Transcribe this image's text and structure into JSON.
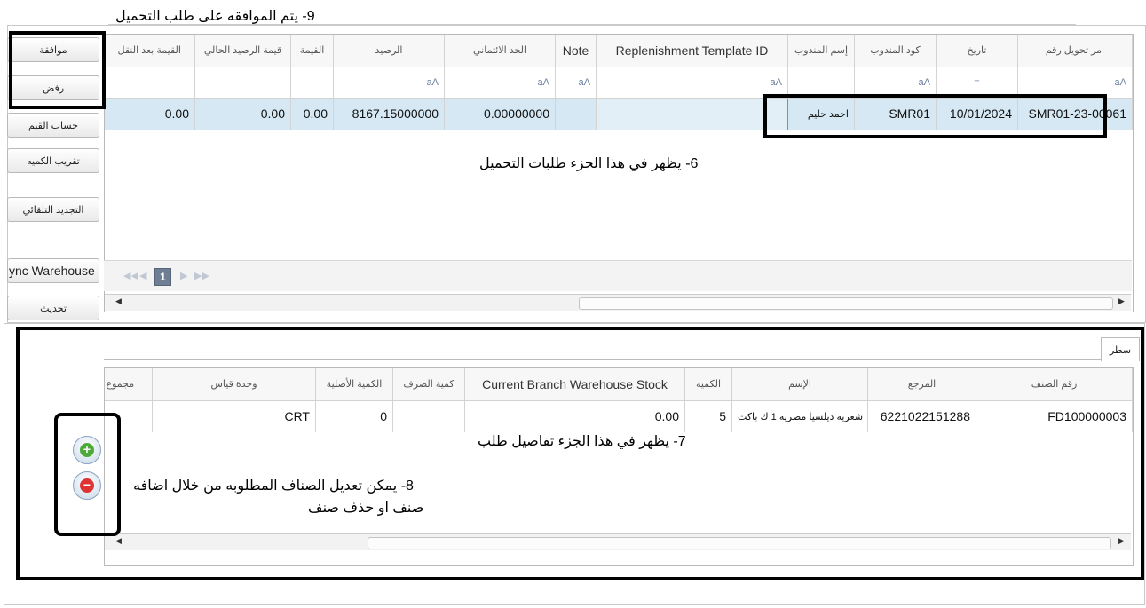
{
  "annotations": {
    "n9": "9- يتم الموافقه على طلب التحميل",
    "n6": "6- يظهر في هذا الجزء طلبات التحميل",
    "n7": "7- يظهر في هذا الجزء تفاصيل طلب",
    "n8_line1": "8- يمكن تعديل الصناف المطلوبه من خلال اضافه",
    "n8_line2": "صنف او حذف صنف"
  },
  "actions": {
    "approve": "موافقة",
    "reject": "رفض",
    "calc_values": "حساب القيم",
    "round_qty": "تقريب الكميه",
    "auto_renew": "التجديد التلقائي",
    "sync_warehouse": "ync Warehouse",
    "refresh": "تحديث"
  },
  "requests": {
    "headers": [
      "امر تحويل رقم",
      "تاريخ",
      "كود المندوب",
      "إسم المندوب",
      "Replenishment Template ID",
      "Note",
      "الحد الائتماني",
      "الرصيد",
      "القيمة",
      "قيمة الرصيد الحالي",
      "القيمة بعد النقل"
    ],
    "filters": [
      "aA",
      "=",
      "aA",
      "",
      "aA",
      "aA",
      "aA",
      "aA",
      "",
      "",
      ""
    ],
    "row": [
      "SMR01-23-00061",
      "10/01/2024",
      "SMR01",
      "احمد حليم",
      "",
      "",
      "0.00000000",
      "8167.15000000",
      "0.00",
      "0.00",
      "0.00"
    ],
    "page": "1"
  },
  "details": {
    "tab": "سطر",
    "headers": [
      "رقم الصنف",
      "المرجع",
      "الإسم",
      "الكميه",
      "Current Branch Warehouse Stock",
      "كمية الصرف",
      "الكمية الأصلية",
      "وحدة قياس",
      "مجموع"
    ],
    "row": [
      "FD100000003",
      "6221022151288",
      "شعريه ديلسيا مصريه 1 ك باكت",
      "5",
      "0.00",
      "",
      "0",
      "CRT",
      ""
    ]
  },
  "icons": {
    "filter": "filter-icon",
    "row_indicator": "row-pointer-icon",
    "add": "plus-icon",
    "remove": "minus-icon"
  }
}
